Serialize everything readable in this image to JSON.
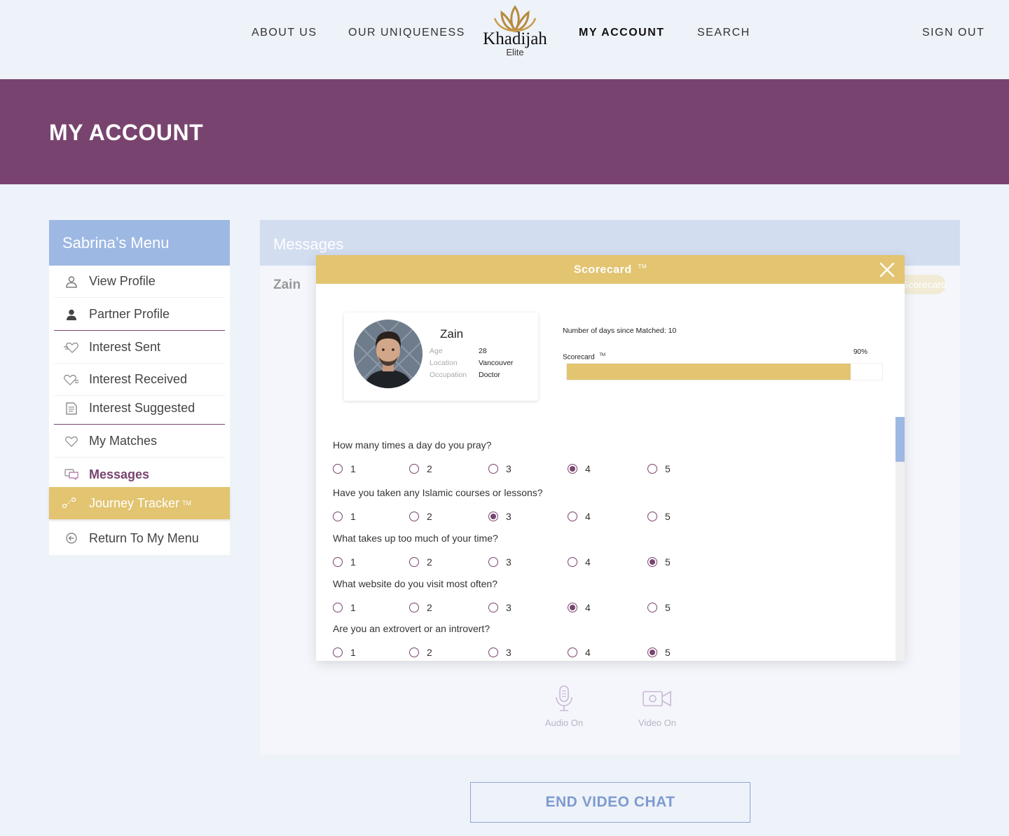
{
  "nav": {
    "about": "ABOUT US",
    "uniqueness": "OUR UNIQUENESS",
    "account": "MY ACCOUNT",
    "search": "SEARCH",
    "signout": "SIGN OUT"
  },
  "logo": {
    "name": "Khadijah",
    "sub": "Elite"
  },
  "banner": {
    "title": "MY ACCOUNT"
  },
  "sidebar": {
    "title": "Sabrina’s Menu",
    "items": [
      {
        "label": "View Profile",
        "icon": "user-outline-icon"
      },
      {
        "label": "Partner Profile",
        "icon": "user-filled-icon"
      },
      {
        "label": "Interest Sent",
        "icon": "heart-send-icon"
      },
      {
        "label": "Interest Received",
        "icon": "heart-receive-icon"
      },
      {
        "label": "Interest Suggested",
        "icon": "document-icon"
      },
      {
        "label": "My Matches",
        "icon": "heart-icon"
      },
      {
        "label": "Messages",
        "icon": "chat-icon"
      },
      {
        "label": "Journey Tracker",
        "tm": "TM",
        "icon": "journey-icon"
      },
      {
        "label": "Return To My Menu",
        "icon": "return-icon"
      }
    ]
  },
  "panel": {
    "title": "Messages",
    "contact": "Zain",
    "scorecard_btn": "Scorecard",
    "audio": "Audio On",
    "video": "Video On"
  },
  "end_button": "END VIDEO CHAT",
  "modal": {
    "title": "Scorecard",
    "tm": "TM",
    "profile": {
      "name": "Zain",
      "age_label": "Age",
      "age": "28",
      "location_label": "Location",
      "location": "Vancouver",
      "occupation_label": "Occupation",
      "occupation": "Doctor"
    },
    "days_text": "Number of days since Matched: 10",
    "score_label": "Scorecard",
    "score_pct_text": "90%",
    "score_fraction": 0.9,
    "questions": [
      {
        "text": "How many times a day do you pray?",
        "options": [
          "1",
          "2",
          "3",
          "4",
          "5"
        ],
        "selected": 4
      },
      {
        "text": "Have you taken any Islamic courses or lessons?",
        "options": [
          "1",
          "2",
          "3",
          "4",
          "5"
        ],
        "selected": 3
      },
      {
        "text": "What takes up too much of your time?",
        "options": [
          "1",
          "2",
          "3",
          "4",
          "5"
        ],
        "selected": 5
      },
      {
        "text": "What website do you visit most often?",
        "options": [
          "1",
          "2",
          "3",
          "4",
          "5"
        ],
        "selected": 4
      },
      {
        "text": "Are you an extrovert or an introvert?",
        "options": [
          "1",
          "2",
          "3",
          "4",
          "5"
        ],
        "selected": 5
      }
    ]
  },
  "colors": {
    "purple": "#78446f",
    "gold": "#e2c471",
    "blue": "#9db8e3",
    "background": "#eef2f9"
  }
}
